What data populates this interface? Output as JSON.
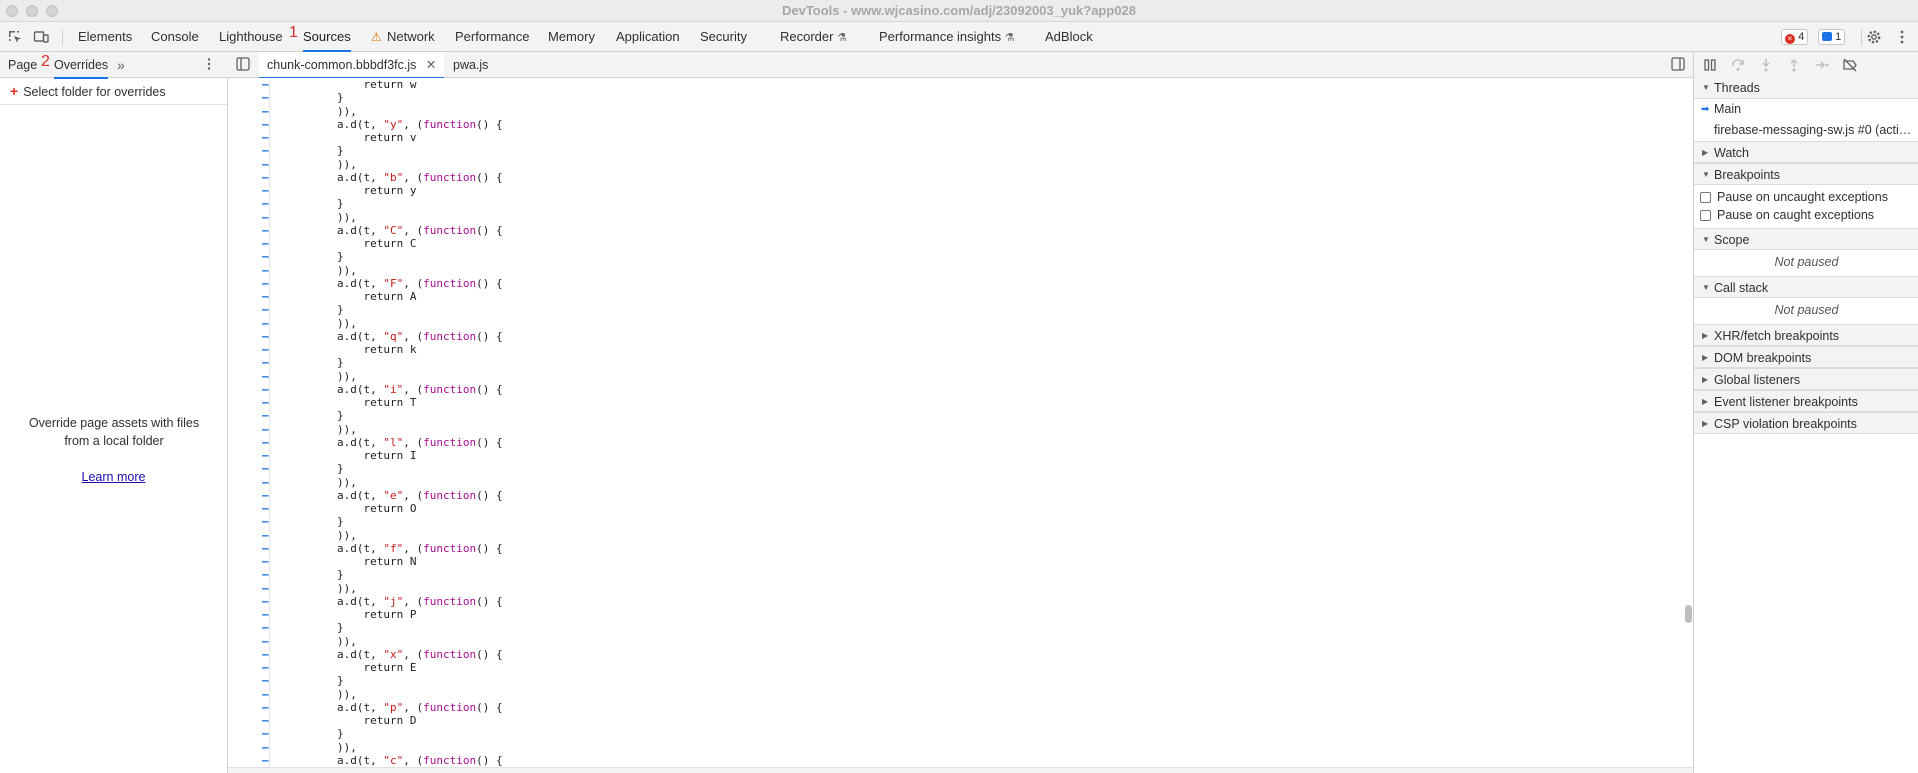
{
  "window": {
    "title": "DevTools - www.wjcasino.com/adj/23092003_yuk?app028"
  },
  "toolbar": {
    "tabs": [
      {
        "label": "Elements"
      },
      {
        "label": "Console"
      },
      {
        "label": "Lighthouse"
      },
      {
        "label": "Sources"
      },
      {
        "label": "Network"
      },
      {
        "label": "Performance"
      },
      {
        "label": "Memory"
      },
      {
        "label": "Application"
      },
      {
        "label": "Security"
      },
      {
        "label": "Recorder"
      },
      {
        "label": "Performance insights"
      },
      {
        "label": "AdBlock"
      }
    ],
    "active_tab": "Sources",
    "marker_1": "1",
    "errors_count": "4",
    "messages_count": "1",
    "accent_color": "#1a73e8",
    "error_color": "#d93025",
    "warning_color": "#e37400"
  },
  "navigator": {
    "tabs": [
      {
        "label": "Page"
      },
      {
        "label": "Overrides"
      }
    ],
    "active_tab": "Overrides",
    "marker_2": "2",
    "more_tabs_icon": "double-chevron-right",
    "select_folder_label": "Select folder for overrides",
    "empty_message_line1": "Override page assets with files",
    "empty_message_line2": "from a local folder",
    "learn_more": "Learn more"
  },
  "editor": {
    "tabs": [
      {
        "label": "chunk-common.bbbdf3fc.js",
        "closable": true
      },
      {
        "label": "pwa.js",
        "closable": false
      }
    ],
    "active_tab": "chunk-common.bbbdf3fc.js",
    "lines": [
      {
        "segments": [
          {
            "t": "            return w",
            "c": ""
          }
        ]
      },
      {
        "segments": [
          {
            "t": "        }",
            "c": ""
          }
        ]
      },
      {
        "segments": [
          {
            "t": "        )),",
            "c": ""
          }
        ]
      },
      {
        "segments": [
          {
            "t": "        a.d(t, ",
            "c": ""
          },
          {
            "t": "\"y\"",
            "c": "str"
          },
          {
            "t": ", (",
            "c": ""
          },
          {
            "t": "function",
            "c": "kw"
          },
          {
            "t": "() {",
            "c": ""
          }
        ]
      },
      {
        "segments": [
          {
            "t": "            return v",
            "c": ""
          }
        ]
      },
      {
        "segments": [
          {
            "t": "        }",
            "c": ""
          }
        ]
      },
      {
        "segments": [
          {
            "t": "        )),",
            "c": ""
          }
        ]
      },
      {
        "segments": [
          {
            "t": "        a.d(t, ",
            "c": ""
          },
          {
            "t": "\"b\"",
            "c": "str"
          },
          {
            "t": ", (",
            "c": ""
          },
          {
            "t": "function",
            "c": "kw"
          },
          {
            "t": "() {",
            "c": ""
          }
        ]
      },
      {
        "segments": [
          {
            "t": "            return y",
            "c": ""
          }
        ]
      },
      {
        "segments": [
          {
            "t": "        }",
            "c": ""
          }
        ]
      },
      {
        "segments": [
          {
            "t": "        )),",
            "c": ""
          }
        ]
      },
      {
        "segments": [
          {
            "t": "        a.d(t, ",
            "c": ""
          },
          {
            "t": "\"C\"",
            "c": "str"
          },
          {
            "t": ", (",
            "c": ""
          },
          {
            "t": "function",
            "c": "kw"
          },
          {
            "t": "() {",
            "c": ""
          }
        ]
      },
      {
        "segments": [
          {
            "t": "            return C",
            "c": ""
          }
        ]
      },
      {
        "segments": [
          {
            "t": "        }",
            "c": ""
          }
        ]
      },
      {
        "segments": [
          {
            "t": "        )),",
            "c": ""
          }
        ]
      },
      {
        "segments": [
          {
            "t": "        a.d(t, ",
            "c": ""
          },
          {
            "t": "\"F\"",
            "c": "str"
          },
          {
            "t": ", (",
            "c": ""
          },
          {
            "t": "function",
            "c": "kw"
          },
          {
            "t": "() {",
            "c": ""
          }
        ]
      },
      {
        "segments": [
          {
            "t": "            return A",
            "c": ""
          }
        ]
      },
      {
        "segments": [
          {
            "t": "        }",
            "c": ""
          }
        ]
      },
      {
        "segments": [
          {
            "t": "        )),",
            "c": ""
          }
        ]
      },
      {
        "segments": [
          {
            "t": "        a.d(t, ",
            "c": ""
          },
          {
            "t": "\"q\"",
            "c": "str"
          },
          {
            "t": ", (",
            "c": ""
          },
          {
            "t": "function",
            "c": "kw"
          },
          {
            "t": "() {",
            "c": ""
          }
        ]
      },
      {
        "segments": [
          {
            "t": "            return k",
            "c": ""
          }
        ]
      },
      {
        "segments": [
          {
            "t": "        }",
            "c": ""
          }
        ]
      },
      {
        "segments": [
          {
            "t": "        )),",
            "c": ""
          }
        ]
      },
      {
        "segments": [
          {
            "t": "        a.d(t, ",
            "c": ""
          },
          {
            "t": "\"i\"",
            "c": "str"
          },
          {
            "t": ", (",
            "c": ""
          },
          {
            "t": "function",
            "c": "kw"
          },
          {
            "t": "() {",
            "c": ""
          }
        ]
      },
      {
        "segments": [
          {
            "t": "            return T",
            "c": ""
          }
        ]
      },
      {
        "segments": [
          {
            "t": "        }",
            "c": ""
          }
        ]
      },
      {
        "segments": [
          {
            "t": "        )),",
            "c": ""
          }
        ]
      },
      {
        "segments": [
          {
            "t": "        a.d(t, ",
            "c": ""
          },
          {
            "t": "\"l\"",
            "c": "str"
          },
          {
            "t": ", (",
            "c": ""
          },
          {
            "t": "function",
            "c": "kw"
          },
          {
            "t": "() {",
            "c": ""
          }
        ]
      },
      {
        "segments": [
          {
            "t": "            return I",
            "c": ""
          }
        ]
      },
      {
        "segments": [
          {
            "t": "        }",
            "c": ""
          }
        ]
      },
      {
        "segments": [
          {
            "t": "        )),",
            "c": ""
          }
        ]
      },
      {
        "segments": [
          {
            "t": "        a.d(t, ",
            "c": ""
          },
          {
            "t": "\"e\"",
            "c": "str"
          },
          {
            "t": ", (",
            "c": ""
          },
          {
            "t": "function",
            "c": "kw"
          },
          {
            "t": "() {",
            "c": ""
          }
        ]
      },
      {
        "segments": [
          {
            "t": "            return O",
            "c": ""
          }
        ]
      },
      {
        "segments": [
          {
            "t": "        }",
            "c": ""
          }
        ]
      },
      {
        "segments": [
          {
            "t": "        )),",
            "c": ""
          }
        ]
      },
      {
        "segments": [
          {
            "t": "        a.d(t, ",
            "c": ""
          },
          {
            "t": "\"f\"",
            "c": "str"
          },
          {
            "t": ", (",
            "c": ""
          },
          {
            "t": "function",
            "c": "kw"
          },
          {
            "t": "() {",
            "c": ""
          }
        ]
      },
      {
        "segments": [
          {
            "t": "            return N",
            "c": ""
          }
        ]
      },
      {
        "segments": [
          {
            "t": "        }",
            "c": ""
          }
        ]
      },
      {
        "segments": [
          {
            "t": "        )),",
            "c": ""
          }
        ]
      },
      {
        "segments": [
          {
            "t": "        a.d(t, ",
            "c": ""
          },
          {
            "t": "\"j\"",
            "c": "str"
          },
          {
            "t": ", (",
            "c": ""
          },
          {
            "t": "function",
            "c": "kw"
          },
          {
            "t": "() {",
            "c": ""
          }
        ]
      },
      {
        "segments": [
          {
            "t": "            return P",
            "c": ""
          }
        ]
      },
      {
        "segments": [
          {
            "t": "        }",
            "c": ""
          }
        ]
      },
      {
        "segments": [
          {
            "t": "        )),",
            "c": ""
          }
        ]
      },
      {
        "segments": [
          {
            "t": "        a.d(t, ",
            "c": ""
          },
          {
            "t": "\"x\"",
            "c": "str"
          },
          {
            "t": ", (",
            "c": ""
          },
          {
            "t": "function",
            "c": "kw"
          },
          {
            "t": "() {",
            "c": ""
          }
        ]
      },
      {
        "segments": [
          {
            "t": "            return E",
            "c": ""
          }
        ]
      },
      {
        "segments": [
          {
            "t": "        }",
            "c": ""
          }
        ]
      },
      {
        "segments": [
          {
            "t": "        )),",
            "c": ""
          }
        ]
      },
      {
        "segments": [
          {
            "t": "        a.d(t, ",
            "c": ""
          },
          {
            "t": "\"p\"",
            "c": "str"
          },
          {
            "t": ", (",
            "c": ""
          },
          {
            "t": "function",
            "c": "kw"
          },
          {
            "t": "() {",
            "c": ""
          }
        ]
      },
      {
        "segments": [
          {
            "t": "            return D",
            "c": ""
          }
        ]
      },
      {
        "segments": [
          {
            "t": "        }",
            "c": ""
          }
        ]
      },
      {
        "segments": [
          {
            "t": "        )),",
            "c": ""
          }
        ]
      },
      {
        "segments": [
          {
            "t": "        a.d(t, ",
            "c": ""
          },
          {
            "t": "\"c\"",
            "c": "str"
          },
          {
            "t": ", (",
            "c": ""
          },
          {
            "t": "function",
            "c": "kw"
          },
          {
            "t": "() {",
            "c": ""
          }
        ]
      }
    ]
  },
  "debugger": {
    "toolbar_icons": [
      "pause-icon",
      "step-over-icon",
      "step-into-icon",
      "step-out-icon",
      "step-icon",
      "deactivate-breakpoints-icon"
    ],
    "threads": {
      "title": "Threads",
      "items": [
        "Main",
        "firebase-messaging-sw.js #0 (acti…"
      ]
    },
    "watch": {
      "title": "Watch"
    },
    "breakpoints": {
      "title": "Breakpoints",
      "options": [
        {
          "label": "Pause on uncaught exceptions",
          "checked": false
        },
        {
          "label": "Pause on caught exceptions",
          "checked": false
        }
      ]
    },
    "scope": {
      "title": "Scope",
      "status": "Not paused"
    },
    "call_stack": {
      "title": "Call stack",
      "status": "Not paused"
    },
    "collapsed_sections": [
      "XHR/fetch breakpoints",
      "DOM breakpoints",
      "Global listeners",
      "Event listener breakpoints",
      "CSP violation breakpoints"
    ]
  }
}
